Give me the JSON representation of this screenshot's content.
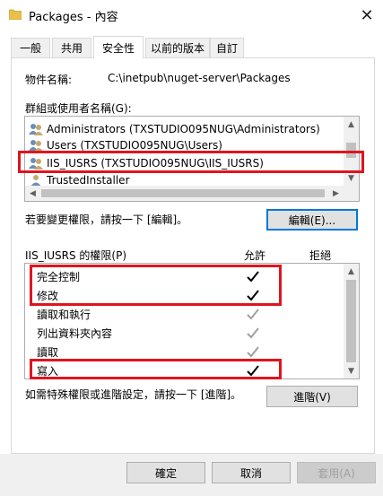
{
  "window": {
    "title": "Packages - 內容",
    "close_glyph": "✕"
  },
  "tabs": [
    {
      "label": "一般"
    },
    {
      "label": "共用"
    },
    {
      "label": "安全性"
    },
    {
      "label": "以前的版本"
    },
    {
      "label": "自訂"
    }
  ],
  "object": {
    "label": "物件名稱:",
    "value": "C:\\inetpub\\nuget-server\\Packages"
  },
  "groups": {
    "label": "群組或使用者名稱(G):",
    "items": [
      {
        "label": "Administrators (TXSTUDIO095NUG\\Administrators)"
      },
      {
        "label": "Users (TXSTUDIO095NUG\\Users)"
      },
      {
        "label": "IIS_IUSRS (TXSTUDIO095NUG\\IIS_IUSRS)"
      },
      {
        "label": "TrustedInstaller"
      }
    ],
    "selected_index": 2
  },
  "edit": {
    "hint": "若要變更權限，請按一下 [編輯]。",
    "button": "編輯(E)..."
  },
  "permissions": {
    "title": "IIS_IUSRS 的權限(P)",
    "allow_header": "允許",
    "deny_header": "拒絕",
    "rows": [
      {
        "name": "完全控制",
        "allow": "explicit"
      },
      {
        "name": "修改",
        "allow": "explicit"
      },
      {
        "name": "讀取和執行",
        "allow": "inherited"
      },
      {
        "name": "列出資料夾內容",
        "allow": "inherited"
      },
      {
        "name": "讀取",
        "allow": "inherited"
      },
      {
        "name": "寫入",
        "allow": "explicit"
      }
    ]
  },
  "advanced": {
    "hint": "如需特殊權限或進階設定，請按一下 [進階]。",
    "button": "進階(V)"
  },
  "footer": {
    "ok": "確定",
    "cancel": "取消",
    "apply": "套用(A)"
  },
  "colors": {
    "highlight_red": "#e0141e",
    "focus_blue": "#0078d7",
    "check_dark": "#000000",
    "check_gray": "#a0a0a0"
  }
}
